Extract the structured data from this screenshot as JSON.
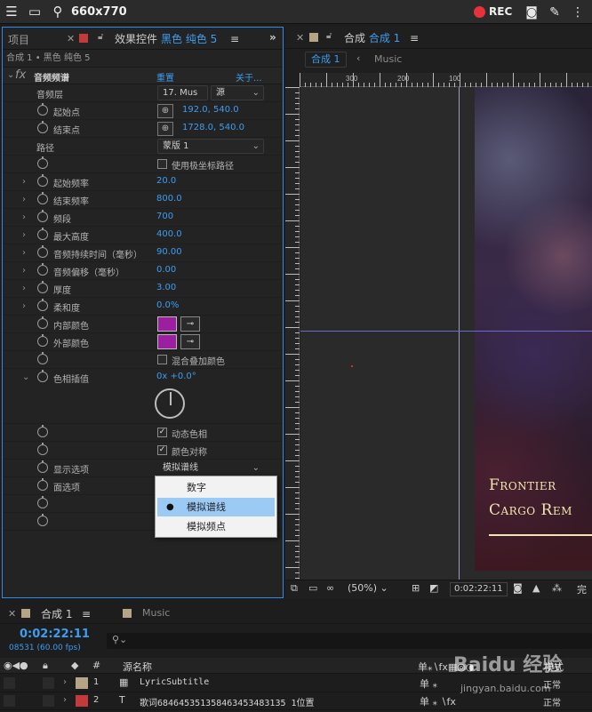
{
  "capture_bar": {
    "dims": "660x770",
    "rec_label": "REC"
  },
  "effect_panel": {
    "tab_project": "项目",
    "tab_effects_prefix": "效果控件",
    "tab_effects_layer": "黑色 纯色 5",
    "subheader": "合成 1 • 黑色 纯色 5",
    "effect_name": "音频频谱",
    "reset_label": "重置",
    "about_label": "关于...",
    "properties": [
      {
        "label": "音频层",
        "value": ""
      },
      {
        "label": "起始点",
        "value": "192.0, 540.0"
      },
      {
        "label": "结束点",
        "value": "1728.0, 540.0"
      },
      {
        "label": "路径",
        "value": ""
      },
      {
        "label": "",
        "value": ""
      },
      {
        "label": "起始频率",
        "value": "20.0"
      },
      {
        "label": "结束频率",
        "value": "800.0"
      },
      {
        "label": "频段",
        "value": "700"
      },
      {
        "label": "最大高度",
        "value": "400.0"
      },
      {
        "label": "音频持续时间（毫秒）",
        "value": "90.00"
      },
      {
        "label": "音频偏移（毫秒）",
        "value": "0.00"
      },
      {
        "label": "厚度",
        "value": "3.00"
      },
      {
        "label": "柔和度",
        "value": "0.0%"
      },
      {
        "label": "内部颜色",
        "value": ""
      },
      {
        "label": "外部颜色",
        "value": ""
      },
      {
        "label": "",
        "value": ""
      },
      {
        "label": "色相插值",
        "value": "0x +0.0°"
      },
      {
        "label": "",
        "value": ""
      },
      {
        "label": "",
        "value": ""
      },
      {
        "label": "显示选项",
        "value": ""
      },
      {
        "label": "面选项",
        "value": ""
      }
    ],
    "audio_layer_select": "17. Mus",
    "source_select": "源",
    "path_select": "蒙版 1",
    "polar_checkbox": "使用极坐标路径",
    "blend_checkbox": "混合叠加颜色",
    "dynamic_hue_checkbox": "动态色相",
    "color_symmetry_checkbox": "颜色对称",
    "display_select": "模拟谱线",
    "inner_color": "#9b1f9f",
    "outer_color": "#9b1f9f",
    "display_options": [
      "数字",
      "模拟谱线",
      "模拟频点"
    ],
    "display_selected_index": 1
  },
  "comp_panel": {
    "tab_prefix": "合成",
    "tab_comp": "合成 1",
    "crumb_active": "合成 1",
    "crumb_other": "Music",
    "ruler_top": [
      "300",
      "200",
      "100"
    ],
    "lyric_line1": "Frontier",
    "lyric_line2": "Cargo Rem",
    "zoom": "(50%)",
    "timecode": "0:02:22:11",
    "tail": "完"
  },
  "timeline": {
    "tab_comp": "合成 1",
    "tab_music": "Music",
    "current_time": "0:02:22:11",
    "frames": "08531 (60.00 fps)",
    "col_number": "#",
    "col_name": "源名称",
    "col_mode": "模式",
    "layers": [
      {
        "num": "1",
        "type": "▦",
        "name": "LyricSubtitle",
        "label_color": "#b5a485",
        "mode": "正常"
      },
      {
        "num": "2",
        "type": "T",
        "name": "歌词684645351358463453483135 1位置",
        "label_color": "#c43a3a",
        "mode": "正常"
      }
    ]
  },
  "watermark": {
    "brand": "Baidu 经验",
    "site": "jingyan.baidu.com"
  }
}
